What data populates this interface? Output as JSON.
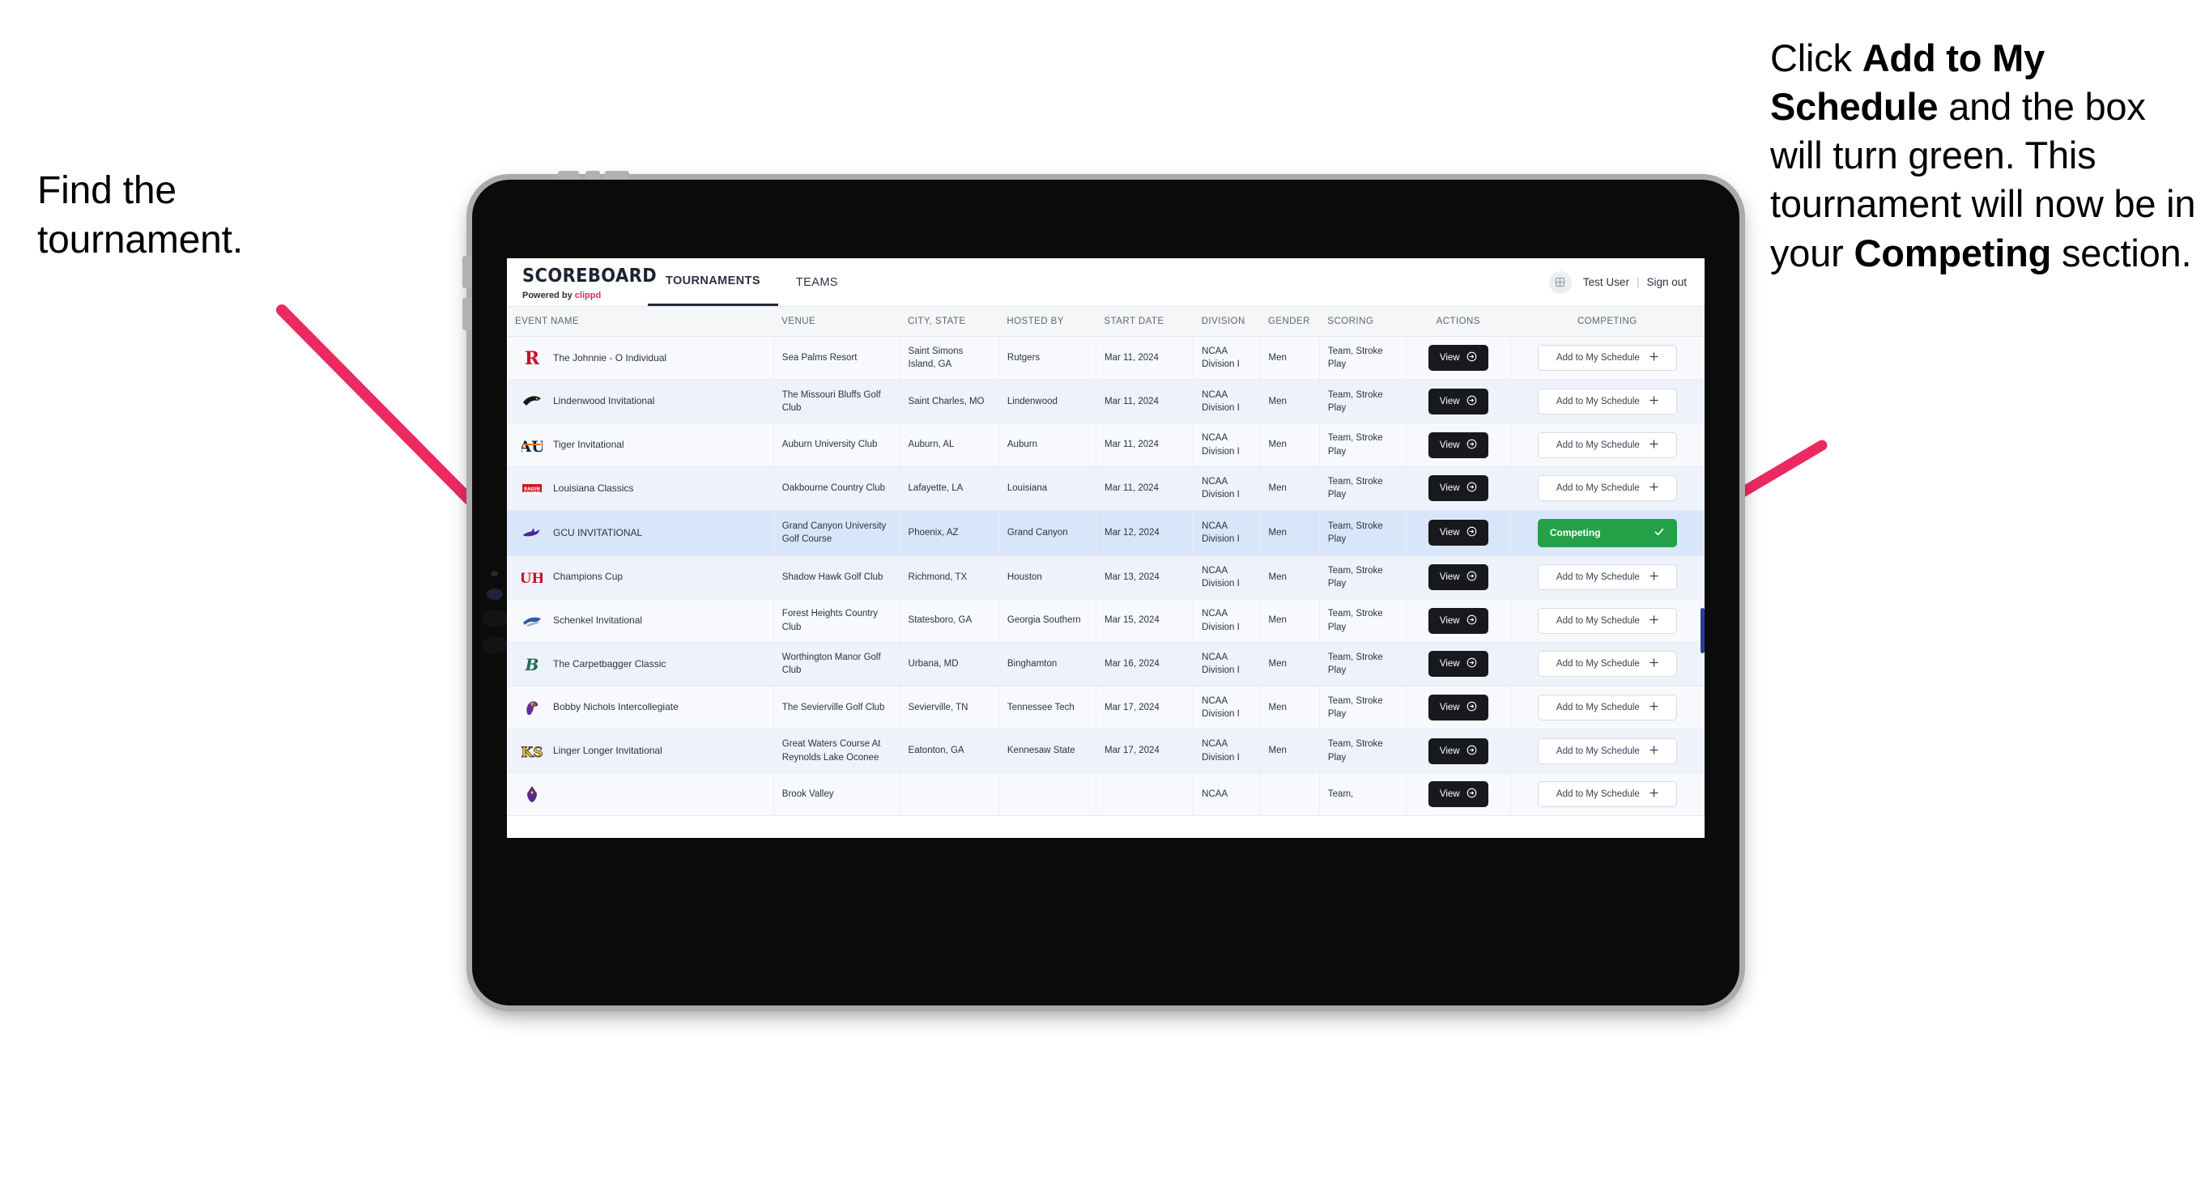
{
  "annotations": {
    "left": {
      "line1": "Find the",
      "line2": "tournament."
    },
    "right": {
      "segments": [
        {
          "text": "Click ",
          "bold": false
        },
        {
          "text": "Add to My Schedule",
          "bold": true
        },
        {
          "text": " and the box will turn green. This tournament will now be in your ",
          "bold": false
        },
        {
          "text": "Competing",
          "bold": true
        },
        {
          "text": " section.",
          "bold": false
        }
      ]
    },
    "arrow_color": "#ec2a60"
  },
  "app": {
    "brand": {
      "title": "SCOREBOARD",
      "powered_prefix": "Powered by ",
      "powered_brand": "clippd",
      "brand_accent": "#f0225f"
    },
    "nav": [
      {
        "label": "TOURNAMENTS",
        "active": true
      },
      {
        "label": "TEAMS",
        "active": false
      }
    ],
    "header_right": {
      "avatar_icon": "grid-icon",
      "user_name": "Test User",
      "separator": "|",
      "sign_out": "Sign out"
    }
  },
  "table": {
    "columns": [
      "EVENT NAME",
      "VENUE",
      "CITY, STATE",
      "HOSTED BY",
      "START DATE",
      "DIVISION",
      "GENDER",
      "SCORING",
      "ACTIONS",
      "COMPETING"
    ],
    "action_label": "View",
    "add_label": "Add to My Schedule",
    "add_icon": "plus-icon",
    "view_icon": "arrow-right-circle-icon",
    "competing_label": "Competing",
    "competing_icon": "check-icon",
    "competing_color": "#24a148",
    "rows": [
      {
        "logo": "rutgers-r-logo",
        "logo_color": "#c8102e",
        "event": "The Johnnie - O Individual",
        "venue": "Sea Palms Resort",
        "city": "Saint Simons Island, GA",
        "host": "Rutgers",
        "date": "Mar 11, 2024",
        "division": "NCAA Division I",
        "gender": "Men",
        "scoring": "Team, Stroke Play",
        "competing": false,
        "selected": false
      },
      {
        "logo": "lindenwood-lion-logo",
        "logo_color": "#1a1a1a",
        "event": "Lindenwood Invitational",
        "venue": "The Missouri Bluffs Golf Club",
        "city": "Saint Charles, MO",
        "host": "Lindenwood",
        "date": "Mar 11, 2024",
        "division": "NCAA Division I",
        "gender": "Men",
        "scoring": "Team, Stroke Play",
        "competing": false,
        "selected": false
      },
      {
        "logo": "auburn-au-logo",
        "logo_color": "#0c2340",
        "event": "Tiger Invitational",
        "venue": "Auburn University Club",
        "city": "Auburn, AL",
        "host": "Auburn",
        "date": "Mar 11, 2024",
        "division": "NCAA Division I",
        "gender": "Men",
        "scoring": "Team, Stroke Play",
        "competing": false,
        "selected": false
      },
      {
        "logo": "louisiana-ragin-cajuns-logo",
        "logo_color": "#ce181e",
        "event": "Louisiana Classics",
        "venue": "Oakbourne Country Club",
        "city": "Lafayette, LA",
        "host": "Louisiana",
        "date": "Mar 11, 2024",
        "division": "NCAA Division I",
        "gender": "Men",
        "scoring": "Team, Stroke Play",
        "competing": false,
        "selected": false
      },
      {
        "logo": "gcu-lopes-logo",
        "logo_color": "#522398",
        "event": "GCU INVITATIONAL",
        "venue": "Grand Canyon University Golf Course",
        "city": "Phoenix, AZ",
        "host": "Grand Canyon",
        "date": "Mar 12, 2024",
        "division": "NCAA Division I",
        "gender": "Men",
        "scoring": "Team, Stroke Play",
        "competing": true,
        "selected": true
      },
      {
        "logo": "houston-uh-logo",
        "logo_color": "#c8102e",
        "event": "Champions Cup",
        "venue": "Shadow Hawk Golf Club",
        "city": "Richmond, TX",
        "host": "Houston",
        "date": "Mar 13, 2024",
        "division": "NCAA Division I",
        "gender": "Men",
        "scoring": "Team, Stroke Play",
        "competing": false,
        "selected": false
      },
      {
        "logo": "georgia-southern-eagles-logo",
        "logo_color": "#2e5d9f",
        "event": "Schenkel Invitational",
        "venue": "Forest Heights Country Club",
        "city": "Statesboro, GA",
        "host": "Georgia Southern",
        "date": "Mar 15, 2024",
        "division": "NCAA Division I",
        "gender": "Men",
        "scoring": "Team, Stroke Play",
        "competing": false,
        "selected": false
      },
      {
        "logo": "binghamton-b-logo",
        "logo_color": "#1f6b52",
        "event": "The Carpetbagger Classic",
        "venue": "Worthington Manor Golf Club",
        "city": "Urbana, MD",
        "host": "Binghamton",
        "date": "Mar 16, 2024",
        "division": "NCAA Division I",
        "gender": "Men",
        "scoring": "Team, Stroke Play",
        "competing": false,
        "selected": false
      },
      {
        "logo": "tennessee-tech-eagle-logo",
        "logo_color": "#6a2c91",
        "event": "Bobby Nichols Intercollegiate",
        "venue": "The Sevierville Golf Club",
        "city": "Sevierville, TN",
        "host": "Tennessee Tech",
        "date": "Mar 17, 2024",
        "division": "NCAA Division I",
        "gender": "Men",
        "scoring": "Team, Stroke Play",
        "competing": false,
        "selected": false
      },
      {
        "logo": "kennesaw-state-ks-logo",
        "logo_color": "#ffc425",
        "event": "Linger Longer Invitational",
        "venue": "Great Waters Course At Reynolds Lake Oconee",
        "city": "Eatonton, GA",
        "host": "Kennesaw State",
        "date": "Mar 17, 2024",
        "division": "NCAA Division I",
        "gender": "Men",
        "scoring": "Team, Stroke Play",
        "competing": false,
        "selected": false
      },
      {
        "logo": "east-carolina-pirates-logo",
        "logo_color": "#592a8a",
        "event": "",
        "venue": "Brook Valley",
        "city": "",
        "host": "",
        "date": "",
        "division": "NCAA",
        "gender": "",
        "scoring": "Team,",
        "competing": false,
        "selected": false,
        "clipped": true
      }
    ]
  }
}
